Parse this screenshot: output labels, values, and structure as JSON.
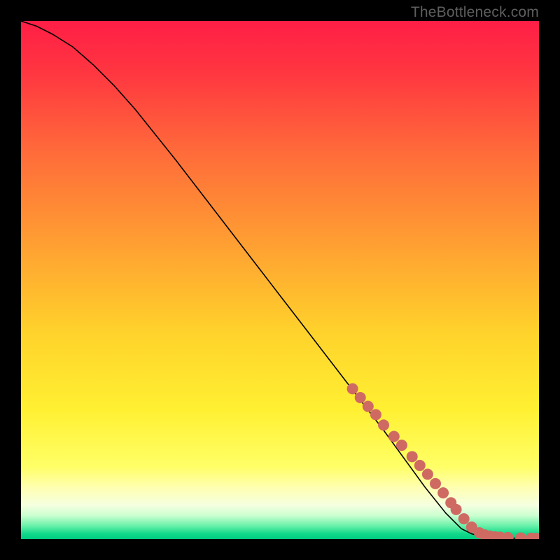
{
  "watermark": "TheBottleneck.com",
  "colors": {
    "curve": "#000000",
    "marker_fill": "#cf6a63",
    "marker_stroke": "#cf6a63",
    "gradient_stops": [
      {
        "offset": 0.0,
        "color": "#ff1e46"
      },
      {
        "offset": 0.1,
        "color": "#ff3640"
      },
      {
        "offset": 0.25,
        "color": "#ff6a3a"
      },
      {
        "offset": 0.45,
        "color": "#ffa531"
      },
      {
        "offset": 0.6,
        "color": "#ffd22b"
      },
      {
        "offset": 0.75,
        "color": "#fff032"
      },
      {
        "offset": 0.86,
        "color": "#ffff66"
      },
      {
        "offset": 0.9,
        "color": "#ffffb0"
      },
      {
        "offset": 0.935,
        "color": "#f5ffe0"
      },
      {
        "offset": 0.955,
        "color": "#c9ffd0"
      },
      {
        "offset": 0.975,
        "color": "#66f0a8"
      },
      {
        "offset": 0.99,
        "color": "#10d98a"
      },
      {
        "offset": 1.0,
        "color": "#00cc80"
      }
    ]
  },
  "chart_data": {
    "type": "line",
    "title": "",
    "xlabel": "",
    "ylabel": "",
    "xlim": [
      0,
      100
    ],
    "ylim": [
      0,
      100
    ],
    "series": [
      {
        "name": "bottleneck-curve",
        "x": [
          0,
          3,
          6,
          10,
          14,
          18,
          22,
          26,
          30,
          35,
          40,
          45,
          50,
          55,
          60,
          65,
          70,
          74,
          78,
          82,
          85,
          87,
          89,
          91,
          94,
          97,
          100
        ],
        "y": [
          100,
          99,
          97.5,
          95,
          91.5,
          87.5,
          83,
          78,
          73,
          66.5,
          60,
          53.5,
          47,
          40.5,
          34,
          27.5,
          21,
          15.5,
          10,
          5,
          2,
          1,
          0.5,
          0.3,
          0.2,
          0.1,
          0.1
        ]
      }
    ],
    "markers": {
      "name": "highlighted-points",
      "x": [
        64,
        65.5,
        67,
        68.5,
        70,
        72,
        73.5,
        75.5,
        77,
        78.5,
        80,
        81.5,
        83,
        84,
        85.5,
        87,
        88.5,
        89.5,
        90.5,
        91.5,
        92.5,
        94,
        96.5,
        98.5,
        99.5
      ],
      "y": [
        29,
        27.3,
        25.6,
        24,
        22,
        19.8,
        18.1,
        15.9,
        14.2,
        12.5,
        10.7,
        8.9,
        7,
        5.7,
        3.9,
        2.3,
        1.2,
        0.8,
        0.55,
        0.4,
        0.35,
        0.28,
        0.2,
        0.15,
        0.12
      ]
    }
  }
}
